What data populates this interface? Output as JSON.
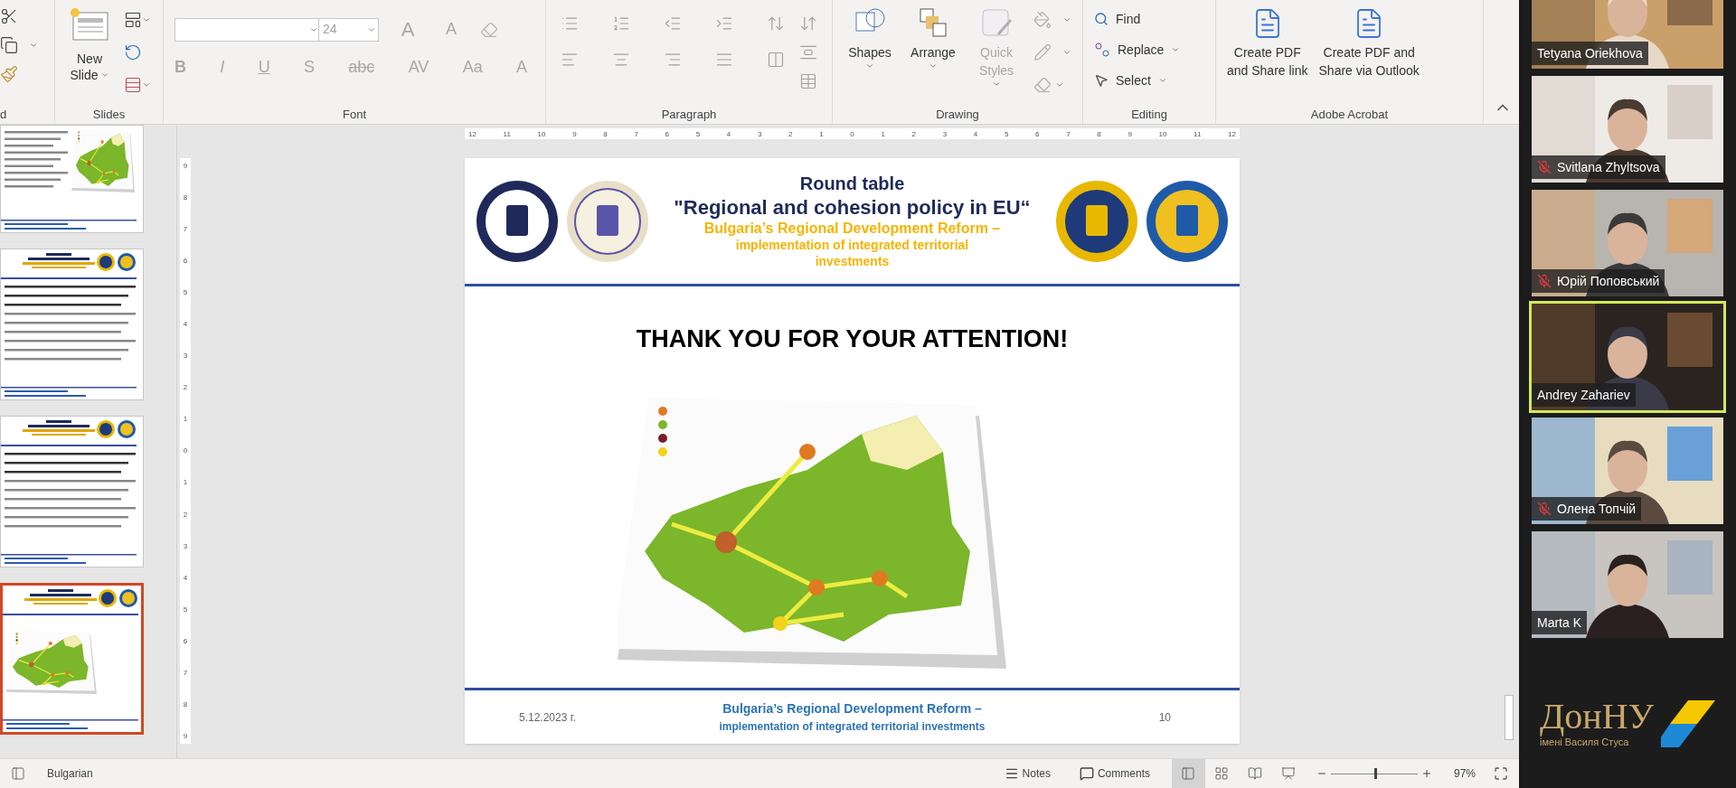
{
  "ribbon": {
    "clipboard": {
      "label": "d"
    },
    "slides": {
      "new_slide": [
        "New",
        "Slide"
      ],
      "label": "Slides"
    },
    "font": {
      "font_size": "24",
      "size_buttons": [
        "A",
        "A"
      ],
      "format_buttons": [
        "B",
        "I",
        "U",
        "S",
        "abc",
        "AV",
        "Aa",
        "A"
      ],
      "disabled": true,
      "label": "Font"
    },
    "paragraph": {
      "disabled": true,
      "label": "Paragraph"
    },
    "drawing": {
      "buttons": [
        {
          "lines": [
            "Shapes"
          ],
          "disabled": false
        },
        {
          "lines": [
            "Arrange"
          ],
          "disabled": false
        },
        {
          "lines": [
            "Quick",
            "Styles"
          ],
          "disabled": true
        }
      ],
      "label": "Drawing"
    },
    "editing": {
      "buttons": [
        "Find",
        "Replace",
        "Select"
      ],
      "label": "Editing"
    },
    "acrobat": {
      "buttons": [
        {
          "lines": [
            "Create PDF",
            "and Share link"
          ]
        },
        {
          "lines": [
            "Create PDF and",
            "Share via Outlook"
          ]
        }
      ],
      "label": "Adobe Acrobat"
    }
  },
  "thumbnails": [
    {
      "selected": false,
      "has_map": true
    },
    {
      "selected": false
    },
    {
      "selected": false
    },
    {
      "selected": true,
      "has_map": true
    }
  ],
  "ruler_h": [
    "12",
    "11",
    "10",
    "9",
    "8",
    "7",
    "6",
    "5",
    "4",
    "3",
    "2",
    "1",
    "0",
    "1",
    "2",
    "3",
    "4",
    "5",
    "6",
    "7",
    "8",
    "9",
    "10",
    "11",
    "12"
  ],
  "ruler_v": [
    "9",
    "8",
    "7",
    "6",
    "5",
    "4",
    "3",
    "2",
    "1",
    "0",
    "1",
    "2",
    "3",
    "4",
    "5",
    "6",
    "7",
    "8",
    "9"
  ],
  "slide": {
    "header": {
      "line1": "Round table",
      "line2": "\"Regional and cohesion policy in EU“",
      "line3": "Bulgaria’s Regional Development Reform –",
      "line4": "implementation of integrated territorial investments"
    },
    "title": "THANK YOU FOR YOUR ATTENTION!",
    "footer": {
      "date": "5.12.2023 г.",
      "line1": "Bulgaria’s Regional Development Reform –",
      "line2": "implementation of integrated territorial investments",
      "page": "10"
    }
  },
  "status_bar": {
    "language": "Bulgarian",
    "notes": "Notes",
    "comments": "Comments",
    "views": [
      {
        "kind": "normal",
        "selected": true
      },
      {
        "kind": "sorter",
        "selected": false
      },
      {
        "kind": "reading",
        "selected": false
      },
      {
        "kind": "slideshow",
        "selected": false
      }
    ],
    "zoom": {
      "level": 0.5,
      "reading": "97%"
    }
  },
  "participants": [
    {
      "name": "Tetyana Oriekhova",
      "muted": false,
      "speaking": false
    },
    {
      "name": "Svitlana Zhyltsova",
      "muted": true,
      "speaking": false
    },
    {
      "name": "Юрій Поповський",
      "muted": true,
      "speaking": false
    },
    {
      "name": "Andrey Zahariev",
      "muted": false,
      "speaking": true
    },
    {
      "name": "Олена Топчій",
      "muted": true,
      "speaking": false
    },
    {
      "name": "Marta K",
      "muted": false,
      "speaking": false
    }
  ],
  "logo": {
    "title": "ДонНУ",
    "subtitle": "імені Василя Стуса"
  }
}
